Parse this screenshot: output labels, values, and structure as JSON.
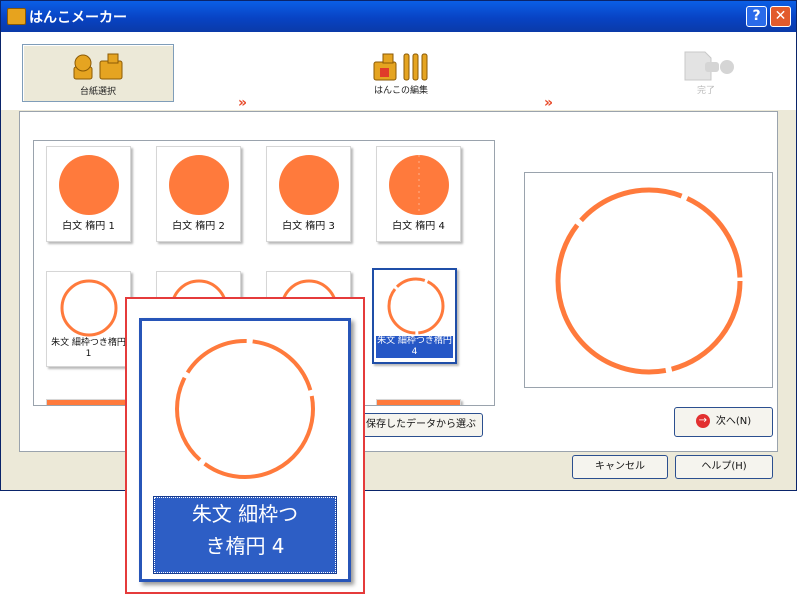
{
  "window": {
    "title": "はんこメーカー",
    "help_button": "?",
    "close_button": "✕"
  },
  "steps": [
    {
      "label": "台紙選択",
      "state": "active"
    },
    {
      "label": "はんこの編集",
      "state": "normal"
    },
    {
      "label": "完了",
      "state": "disabled"
    }
  ],
  "step_arrow": "»",
  "grid": {
    "row1": [
      "白文 楕円 1",
      "白文 楕円 2",
      "白文 楕円 3",
      "白文 楕円 4"
    ],
    "row2": [
      "朱文 細枠つき楕円 1",
      "",
      "",
      "朱文 細枠つき楕円 4"
    ],
    "selected_index": 7
  },
  "buttons": {
    "load_saved": "保存したデータから選ぶ",
    "next": "次へ(N)",
    "cancel": "キャンセル",
    "help": "ヘルプ(H)"
  },
  "zoom": {
    "label_line1": "朱文 細枠つ",
    "label_line2": "き楕円 4"
  },
  "colors": {
    "stamp_orange": "#ff7a3c",
    "selection_blue": "#2d5ec5",
    "zoom_frame_red": "#e53b3b"
  }
}
